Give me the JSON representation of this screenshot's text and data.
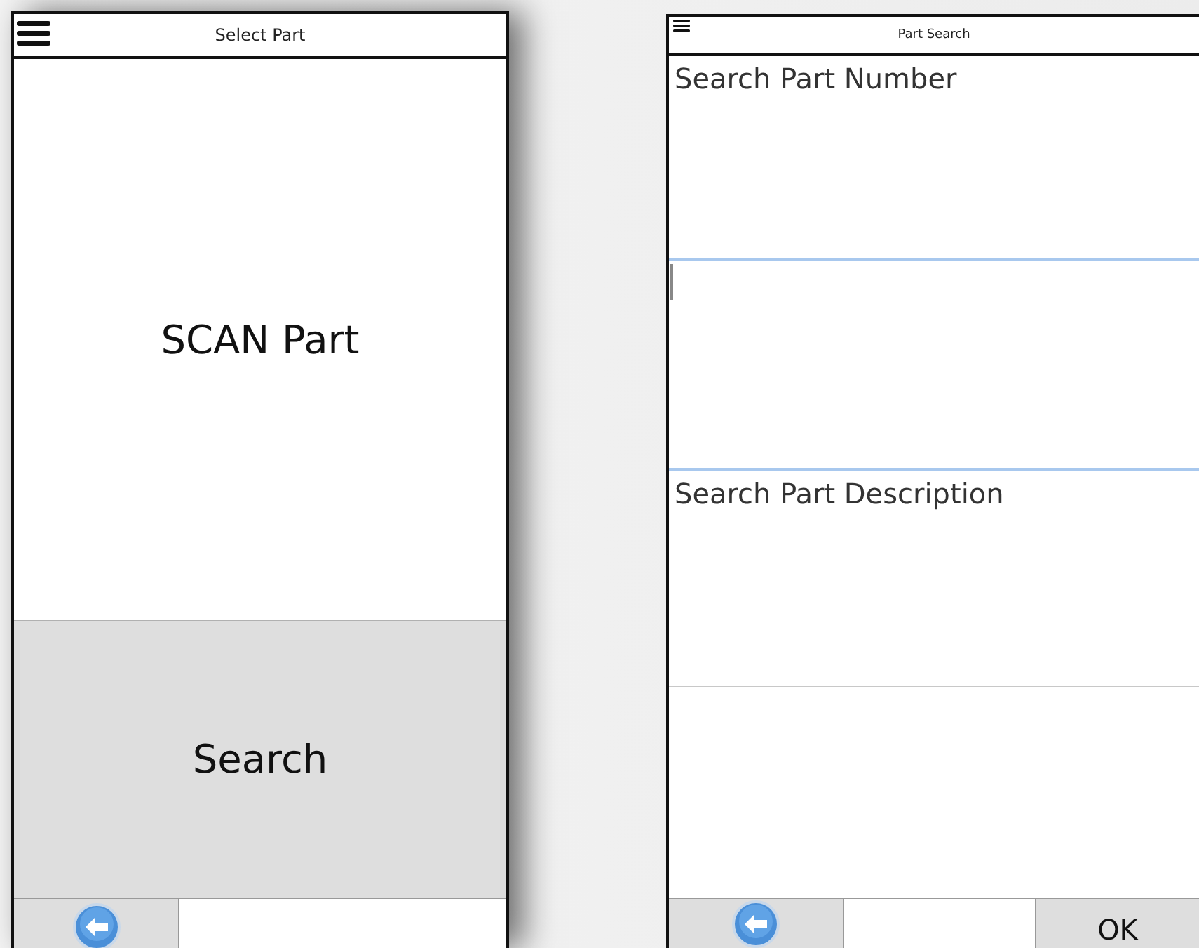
{
  "select_part": {
    "title": "Select Part",
    "scan_label": "SCAN Part",
    "search_label": "Search"
  },
  "part_search": {
    "title": "Part Search",
    "fields": [
      {
        "label": "Search Part Number",
        "focused": true
      },
      {
        "label": "Search Part Description",
        "focused": false
      }
    ],
    "ok_label": "OK"
  }
}
